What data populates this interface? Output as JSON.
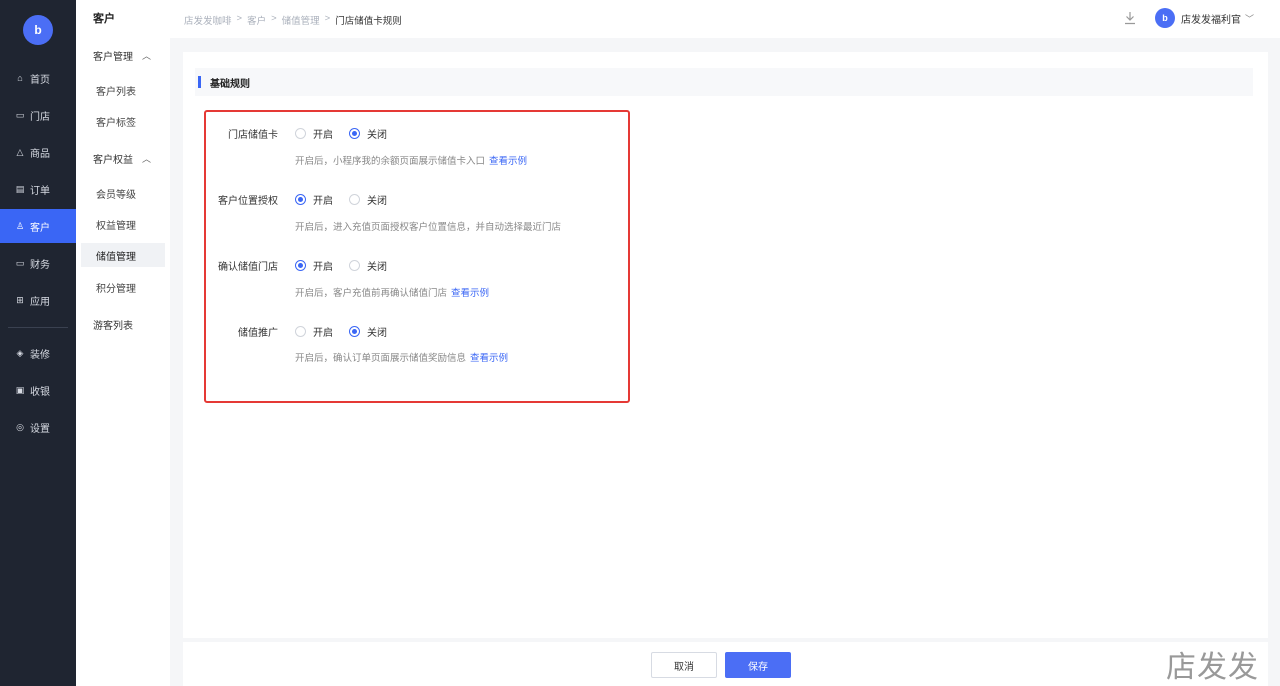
{
  "nav": {
    "logo_text": "b",
    "items": [
      {
        "label": "首页",
        "icon": "home-icon"
      },
      {
        "label": "门店",
        "icon": "store-icon"
      },
      {
        "label": "商品",
        "icon": "goods-icon"
      },
      {
        "label": "订单",
        "icon": "order-icon"
      },
      {
        "label": "客户",
        "icon": "customer-icon"
      },
      {
        "label": "财务",
        "icon": "finance-icon"
      },
      {
        "label": "应用",
        "icon": "apps-icon"
      },
      {
        "label": "装修",
        "icon": "decoration-icon"
      },
      {
        "label": "收银",
        "icon": "cashier-icon"
      },
      {
        "label": "设置",
        "icon": "settings-icon"
      }
    ],
    "active": "客户",
    "accent": "#3a66f5"
  },
  "sub": {
    "title": "客户",
    "group1": "客户管理",
    "group1_items": [
      "客户列表",
      "客户标签"
    ],
    "group2": "客户权益",
    "group2_items": [
      "会员等级",
      "权益管理",
      "储值管理",
      "积分管理"
    ],
    "extra": "游客列表",
    "active": "储值管理"
  },
  "breadcrumb": [
    "店发发咖啡",
    ">",
    "客户",
    ">",
    "储值管理",
    ">",
    "门店储值卡规则"
  ],
  "user": {
    "avatar_text": "b",
    "name": "店发发福利官"
  },
  "section_title": "基础规则",
  "rules": [
    {
      "label": "门店储值卡",
      "on_label": "开启",
      "off_label": "关闭",
      "selected": "off",
      "hint": "开启后，小程序我的余额页面展示储值卡入口",
      "link": "查看示例"
    },
    {
      "label": "客户位置授权",
      "on_label": "开启",
      "off_label": "关闭",
      "selected": "on",
      "hint": "开启后，进入充值页面授权客户位置信息，并自动选择最近门店",
      "link": ""
    },
    {
      "label": "确认储值门店",
      "on_label": "开启",
      "off_label": "关闭",
      "selected": "on",
      "hint": "开启后，客户充值前再确认储值门店",
      "link": "查看示例"
    },
    {
      "label": "储值推广",
      "on_label": "开启",
      "off_label": "关闭",
      "selected": "off",
      "hint": "开启后，确认订单页面展示储值奖励信息",
      "link": "查看示例"
    }
  ],
  "footer": {
    "cancel": "取消",
    "save": "保存"
  },
  "watermark": "店发发"
}
